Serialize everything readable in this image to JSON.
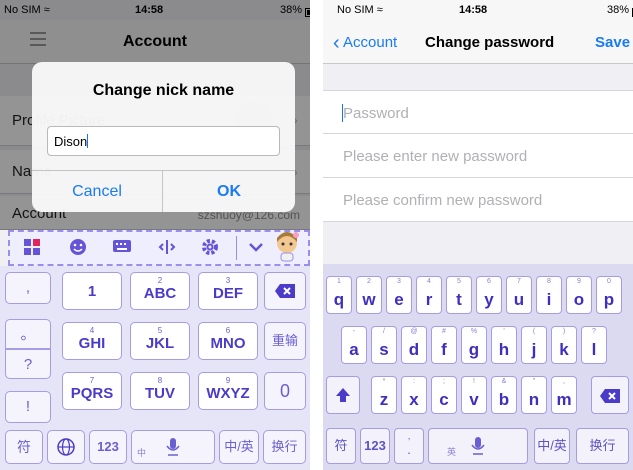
{
  "left": {
    "status": {
      "carrier": "No SIM",
      "time": "14:58",
      "battery": "38%"
    },
    "nav": {
      "title": "Account",
      "menu_icon": "hamburger-icon"
    },
    "rows": [
      {
        "label": "Profile Picture"
      },
      {
        "label": "Name"
      },
      {
        "label": "Account",
        "value": "szshuoy@126.com"
      }
    ],
    "dialog": {
      "title": "Change nick name",
      "input_value": "Dison",
      "cancel": "Cancel",
      "ok": "OK"
    },
    "toolbar_icons": [
      "grid-icon",
      "emoji-icon",
      "keyboard-icon",
      "cursor-icon",
      "gear-icon",
      "collapse-icon",
      "mascot-icon"
    ],
    "keyboard": {
      "left_col": [
        ",",
        "。",
        "?",
        "!"
      ],
      "rows": [
        [
          {
            "sub": "",
            "main": "1"
          },
          {
            "sub": "2",
            "main": "ABC"
          },
          {
            "sub": "3",
            "main": "DEF"
          }
        ],
        [
          {
            "sub": "4",
            "main": "GHI"
          },
          {
            "sub": "5",
            "main": "JKL"
          },
          {
            "sub": "6",
            "main": "MNO"
          }
        ],
        [
          {
            "sub": "7",
            "main": "PQRS"
          },
          {
            "sub": "8",
            "main": "TUV"
          },
          {
            "sub": "9",
            "main": "WXYZ"
          }
        ]
      ],
      "right_col": [
        "⌫",
        "重输",
        "0"
      ],
      "bottom": {
        "symbol": "符",
        "globe": "globe-icon",
        "num": "123",
        "space_sub": "中",
        "mic": "mic-icon",
        "switch": "中/英",
        "enter": "换行"
      }
    }
  },
  "right": {
    "status": {
      "carrier": "No SIM",
      "time": "14:58",
      "battery": "38%"
    },
    "nav": {
      "back": "Account",
      "title": "Change password",
      "save": "Save"
    },
    "fields": [
      {
        "placeholder": "Password"
      },
      {
        "placeholder": "Please enter new password"
      },
      {
        "placeholder": "Please confirm new password"
      }
    ],
    "keyboard": {
      "row1": [
        {
          "sub": "1",
          "main": "q"
        },
        {
          "sub": "2",
          "main": "w"
        },
        {
          "sub": "3",
          "main": "e"
        },
        {
          "sub": "4",
          "main": "r"
        },
        {
          "sub": "5",
          "main": "t"
        },
        {
          "sub": "6",
          "main": "y"
        },
        {
          "sub": "7",
          "main": "u"
        },
        {
          "sub": "8",
          "main": "i"
        },
        {
          "sub": "9",
          "main": "o"
        },
        {
          "sub": "0",
          "main": "p"
        }
      ],
      "row2": [
        {
          "sub": "-",
          "main": "a"
        },
        {
          "sub": "/",
          "main": "s"
        },
        {
          "sub": "@",
          "main": "d"
        },
        {
          "sub": "#",
          "main": "f"
        },
        {
          "sub": "%",
          "main": "g"
        },
        {
          "sub": "'",
          "main": "h"
        },
        {
          "sub": "(",
          "main": "j"
        },
        {
          "sub": ")",
          "main": "k"
        },
        {
          "sub": "?",
          "main": "l"
        }
      ],
      "row3": [
        {
          "sub": "*",
          "main": "z"
        },
        {
          "sub": ":",
          "main": "x"
        },
        {
          "sub": ";",
          "main": "c"
        },
        {
          "sub": "!",
          "main": "v"
        },
        {
          "sub": "&",
          "main": "b"
        },
        {
          "sub": "\"",
          "main": "n"
        },
        {
          "sub": ",",
          "main": "m"
        }
      ],
      "shift": "shift-icon",
      "delete": "delete-icon",
      "bottom": {
        "symbol": "符",
        "num": "123",
        "comma": ",",
        "period": ".",
        "space_sub": "英",
        "mic": "mic-icon",
        "switch": "中/英",
        "enter": "换行"
      }
    }
  }
}
